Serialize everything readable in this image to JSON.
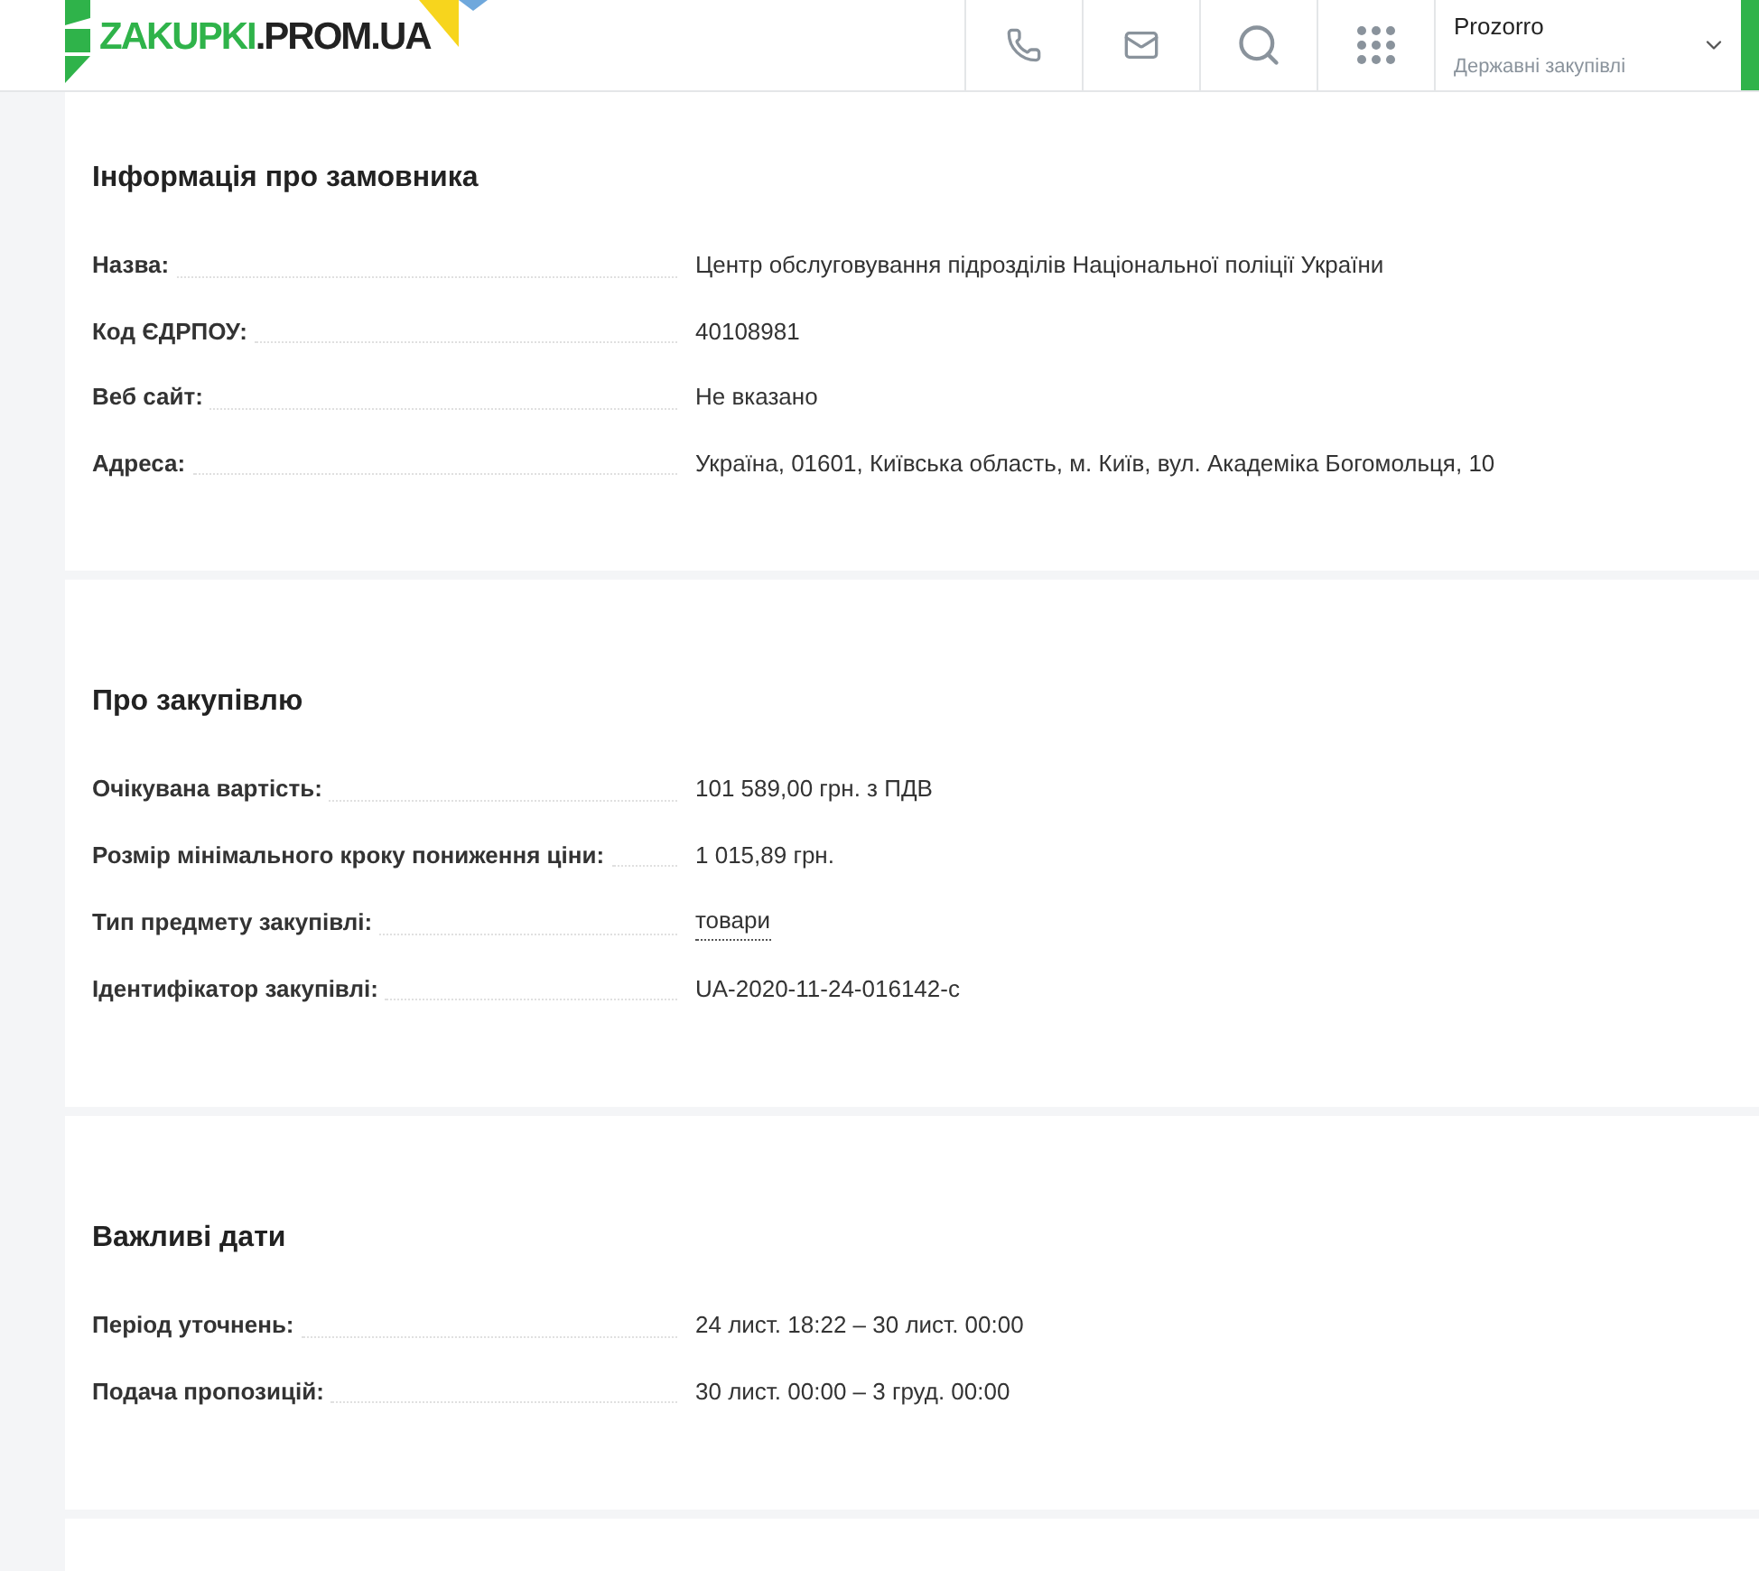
{
  "header": {
    "logo": [
      "ZAKUPKI",
      ".PROM.UA"
    ],
    "platform": {
      "name": "Prozorro",
      "subtitle": "Державні закупівлі"
    }
  },
  "sections": [
    {
      "title": "Інформація про замовника",
      "rows": [
        {
          "label": "Назва:",
          "value": "Центр обслуговування підрозділів Національної поліції України",
          "underlined": false
        },
        {
          "label": "Код ЄДРПОУ:",
          "value": "40108981",
          "underlined": false
        },
        {
          "label": "Веб сайт:",
          "value": "Не вказано",
          "underlined": false
        },
        {
          "label": "Адреса:",
          "value": "Україна, 01601, Київська область, м. Київ, вул. Академіка Богомольця, 10",
          "underlined": false
        }
      ]
    },
    {
      "title": "Про закупівлю",
      "rows": [
        {
          "label": "Очікувана вартість:",
          "value": "101 589,00 грн. з ПДВ",
          "underlined": false
        },
        {
          "label": "Розмір мінімального кроку пониження ціни:",
          "value": "1 015,89 грн.",
          "underlined": false
        },
        {
          "label": "Тип предмету закупівлі:",
          "value": "товари",
          "underlined": true
        },
        {
          "label": "Ідентифікатор закупівлі:",
          "value": "UA-2020-11-24-016142-c",
          "underlined": false
        }
      ]
    },
    {
      "title": "Важливі дати",
      "rows": [
        {
          "label": "Період уточнень:",
          "value": "24 лист. 18:22 – 30 лист. 00:00",
          "underlined": false
        },
        {
          "label": "Подача пропозицій:",
          "value": "30 лист. 00:00 – 3 груд. 00:00",
          "underlined": false
        }
      ]
    }
  ]
}
